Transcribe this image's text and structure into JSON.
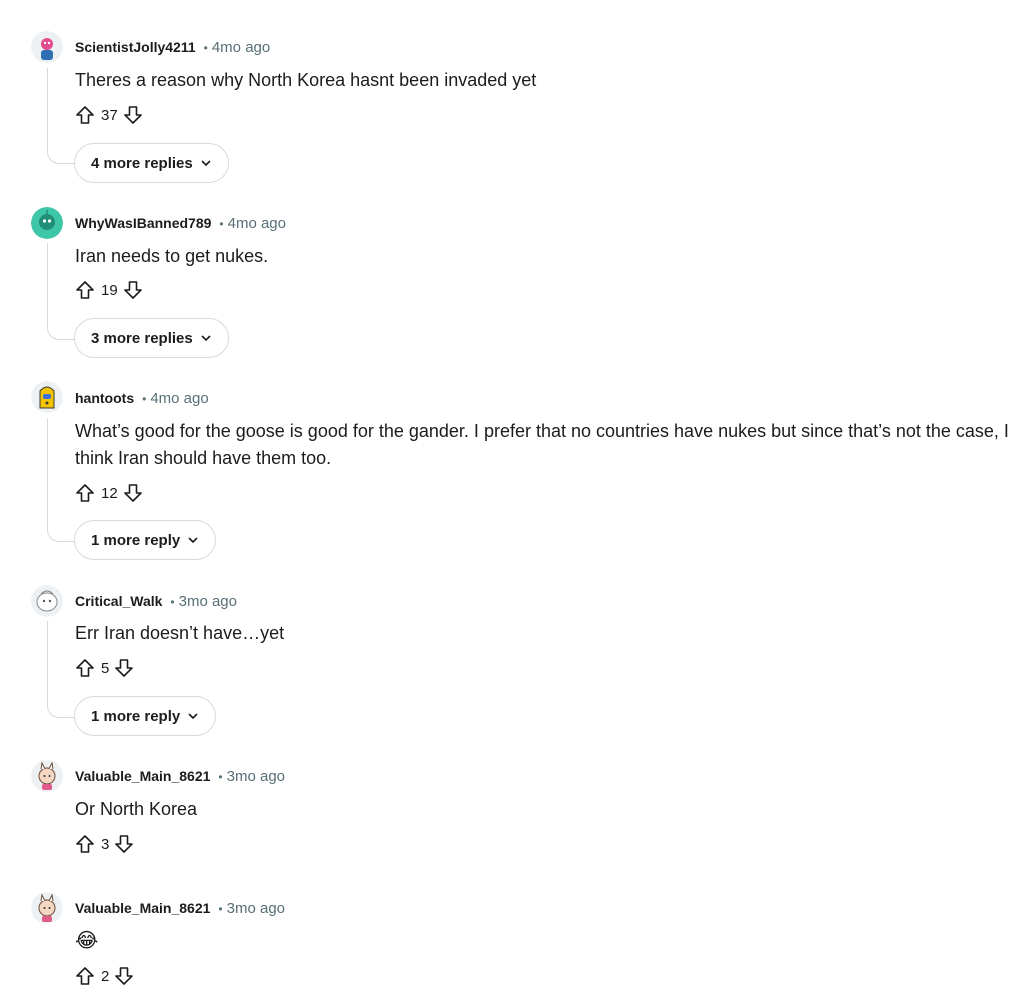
{
  "comments": [
    {
      "user": "ScientistJolly4211",
      "sep": "•",
      "time": "4mo ago",
      "text": "Theres a reason why North Korea hasnt been invaded yet",
      "score": "37",
      "more": "4 more replies",
      "avatar_color": "#e34c8f"
    },
    {
      "user": "WhyWasIBanned789",
      "sep": "•",
      "time": "4mo ago",
      "text": "Iran needs to get nukes.",
      "score": "19",
      "more": "3 more replies",
      "avatar_color": "#3ec7a6"
    },
    {
      "user": "hantoots",
      "sep": "•",
      "time": "4mo ago",
      "text": "What’s good for the goose is good for the gander. I prefer that no countries have nukes but since that’s not the case, I think Iran should have them too.",
      "score": "12",
      "more": "1 more reply",
      "avatar_color": "#f5c400"
    },
    {
      "user": "Critical_Walk",
      "sep": "•",
      "time": "3mo ago",
      "text": "Err Iran doesn’t have…yet",
      "score": "5",
      "more": "1 more reply",
      "avatar_color": "#e8ecef"
    },
    {
      "user": "Valuable_Main_8621",
      "sep": "•",
      "time": "3mo ago",
      "text": "Or North Korea",
      "score": "3",
      "avatar_color": "#f3d7c2"
    },
    {
      "user": "Valuable_Main_8621",
      "sep": "•",
      "time": "3mo ago",
      "text": "😂",
      "score": "2",
      "avatar_color": "#f3d7c2"
    }
  ]
}
